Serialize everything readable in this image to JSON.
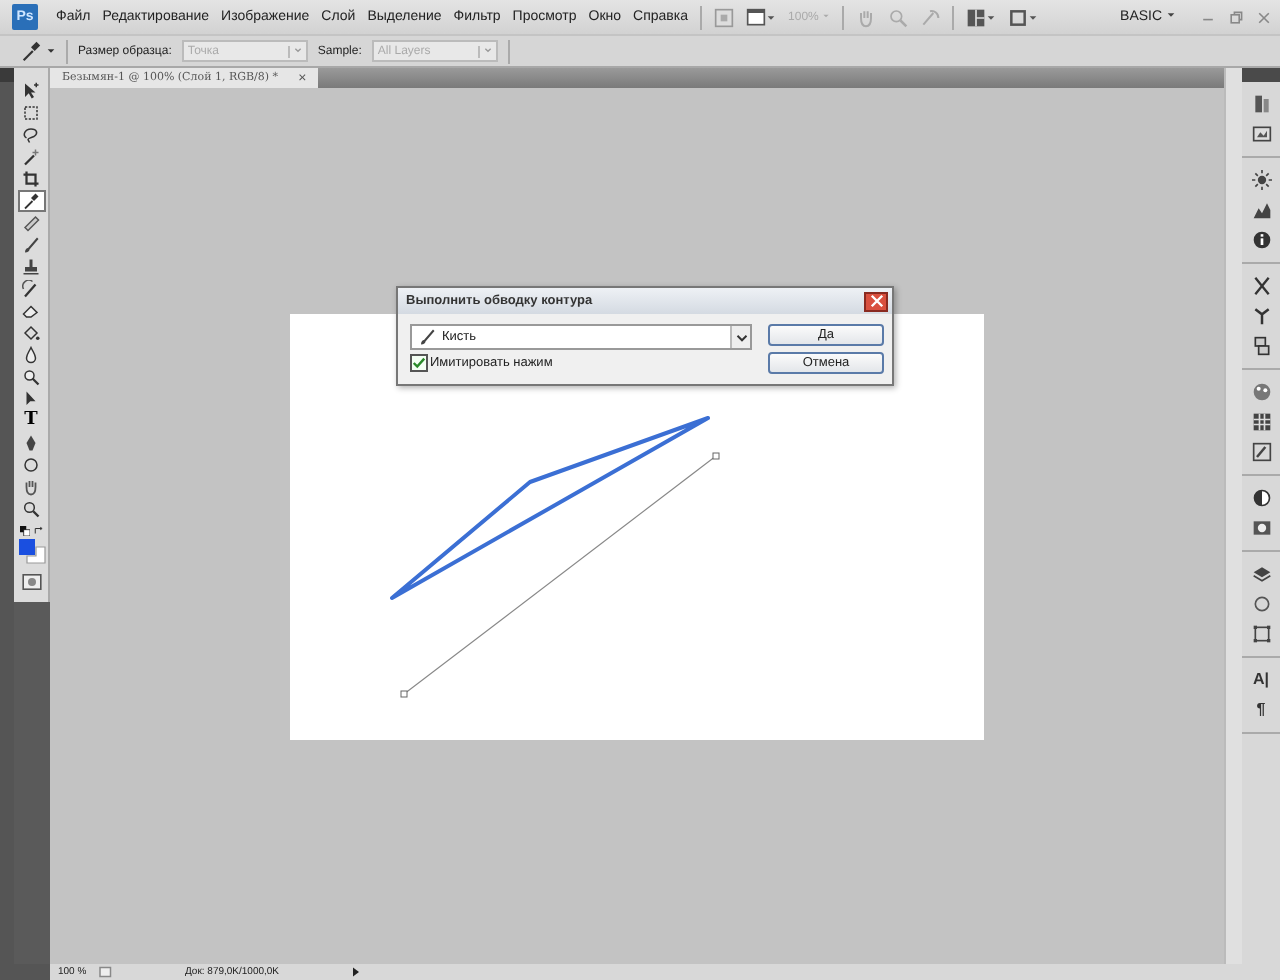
{
  "app_bar": {
    "logo": "Ps",
    "menu": [
      "Файл",
      "Редактирование",
      "Изображение",
      "Слой",
      "Выделение",
      "Фильтр",
      "Просмотр",
      "Окно",
      "Справка"
    ],
    "zoom": "100%",
    "workspace": "BASIC"
  },
  "options_bar": {
    "sample_size_label": "Размер образца:",
    "sample_size_value": "Точка",
    "sample_size_disabled": true,
    "sample_label": "Sample:",
    "sample_value": "All Layers",
    "sample_disabled": true
  },
  "document_tab": {
    "title": "Безымян-1 @ 100% (Слой 1, RGB/8) *",
    "close": "×"
  },
  "tools": [
    {
      "kind": "move",
      "selected": false
    },
    {
      "kind": "marquee",
      "selected": false
    },
    {
      "kind": "lasso",
      "selected": false
    },
    {
      "kind": "wand",
      "selected": false
    },
    {
      "kind": "crop",
      "selected": false
    },
    {
      "kind": "eyedropper",
      "selected": true
    },
    {
      "kind": "heal",
      "selected": false
    },
    {
      "kind": "brush",
      "selected": false
    },
    {
      "kind": "stamp",
      "selected": false
    },
    {
      "kind": "history",
      "selected": false
    },
    {
      "kind": "eraser",
      "selected": false
    },
    {
      "kind": "bucket",
      "selected": false
    },
    {
      "kind": "blur",
      "selected": false
    },
    {
      "kind": "dodge",
      "selected": false
    },
    {
      "kind": "pathsel",
      "selected": false
    },
    {
      "kind": "type",
      "glyph": "T",
      "selected": false
    },
    {
      "kind": "pen",
      "selected": false
    },
    {
      "kind": "shape",
      "selected": false
    },
    {
      "kind": "hand",
      "selected": false
    },
    {
      "kind": "zoom",
      "selected": false
    }
  ],
  "swatches": [
    {
      "kind": "foreground",
      "color": "#1a4fe0"
    },
    {
      "kind": "background",
      "color": "#ffffff"
    }
  ],
  "panel_groups": [
    [
      {
        "kind": "bridge"
      },
      {
        "kind": "frame"
      }
    ],
    [
      {
        "kind": "sun"
      },
      {
        "kind": "landscape"
      },
      {
        "kind": "info"
      }
    ],
    [
      {
        "kind": "scissors"
      },
      {
        "kind": "preset"
      },
      {
        "kind": "clone"
      }
    ],
    [
      {
        "kind": "swatch"
      },
      {
        "kind": "grid"
      },
      {
        "kind": "brushframe"
      }
    ],
    [
      {
        "kind": "halfcircle"
      },
      {
        "kind": "mask"
      }
    ],
    [
      {
        "kind": "layers"
      },
      {
        "kind": "circle"
      },
      {
        "kind": "transform"
      }
    ],
    [
      {
        "kind": "glyph",
        "glyph": "A|"
      },
      {
        "kind": "glyph",
        "glyph": "¶"
      }
    ]
  ],
  "dialog": {
    "title": "Выполнить обводку контура",
    "tool": "Кисть",
    "simulate_pressure": {
      "label": "Имитировать нажим",
      "checked": true
    },
    "buttons": [
      "Да",
      "Отмена"
    ]
  },
  "status_bar": {
    "zoom": "100 %",
    "doc": "Док: 879,0K/1000,0K"
  }
}
